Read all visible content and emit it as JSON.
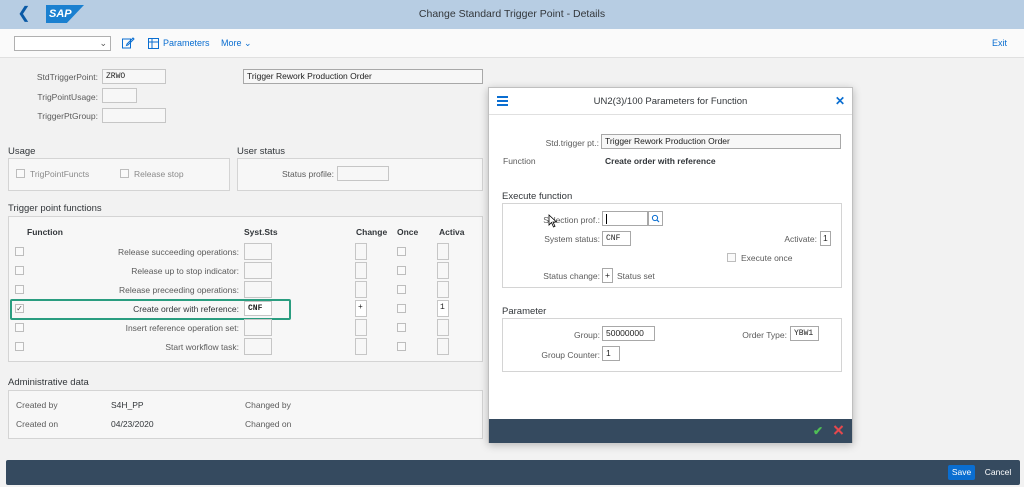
{
  "shell": {
    "title": "Change Standard Trigger Point - Details",
    "logo": "SAP"
  },
  "toolbar": {
    "parameters": "Parameters",
    "more": "More",
    "exit": "Exit"
  },
  "header": {
    "std_trigger_point_label": "StdTriggerPoint:",
    "std_trigger_point_value": "ZRWO",
    "std_trigger_point_desc": "Trigger Rework Production Order",
    "trig_point_usage_label": "TrigPointUsage:",
    "trigger_pt_group_label": "TriggerPtGroup:"
  },
  "usage": {
    "title": "Usage",
    "trig_point_functs": "TrigPointFuncts",
    "release_stop": "Release stop"
  },
  "user_status": {
    "title": "User status",
    "status_profile_label": "Status profile:"
  },
  "functions": {
    "title": "Trigger point functions",
    "col_function": "Function",
    "col_syst_sts": "Syst.Sts",
    "col_change": "Change",
    "col_once": "Once",
    "col_activa": "Activa",
    "rows": [
      {
        "label": "Release succeeding operations:",
        "checked": "",
        "sts": "",
        "change": "",
        "activa": ""
      },
      {
        "label": "Release up to stop indicator:",
        "checked": "",
        "sts": "",
        "change": "",
        "activa": ""
      },
      {
        "label": "Release preceeding operations:",
        "checked": "",
        "sts": "",
        "change": "",
        "activa": ""
      },
      {
        "label": "Create order with reference:",
        "checked": "✓",
        "sts": "CNF",
        "change": "+",
        "activa": "1"
      },
      {
        "label": "Insert reference operation set:",
        "checked": "",
        "sts": "",
        "change": "",
        "activa": ""
      },
      {
        "label": "Start workflow task:",
        "checked": "",
        "sts": "",
        "change": "",
        "activa": ""
      }
    ]
  },
  "admin": {
    "title": "Administrative data",
    "created_by_label": "Created by",
    "created_by_value": "S4H_PP",
    "changed_by_label": "Changed by",
    "created_on_label": "Created on",
    "created_on_value": "04/23/2020",
    "changed_on_label": "Changed on"
  },
  "dialog": {
    "title": "UN2(3)/100 Parameters for Function",
    "std_trigger_label": "Std.trigger pt.:",
    "std_trigger_value": "Trigger Rework Production Order",
    "function_label": "Function",
    "function_value": "Create order with reference",
    "execute_title": "Execute function",
    "selection_prof_label": "Selection prof.:",
    "system_status_label": "System status:",
    "system_status_value": "CNF",
    "activate_label": "Activate:",
    "activate_value": "1",
    "execute_once_label": "Execute once",
    "status_change_label": "Status change:",
    "status_change_value": "+",
    "status_set": "Status set",
    "parameter_title": "Parameter",
    "group_label": "Group:",
    "group_value": "50000000",
    "order_type_label": "Order Type:",
    "order_type_value": "YBW1",
    "group_counter_label": "Group Counter:",
    "group_counter_value": "1"
  },
  "bottom": {
    "save": "Save",
    "cancel": "Cancel"
  },
  "colors": {
    "shell": "#b7cde3",
    "accent": "#0a6ed1",
    "footer": "#354a5f",
    "highlight": "#2a9d80"
  }
}
